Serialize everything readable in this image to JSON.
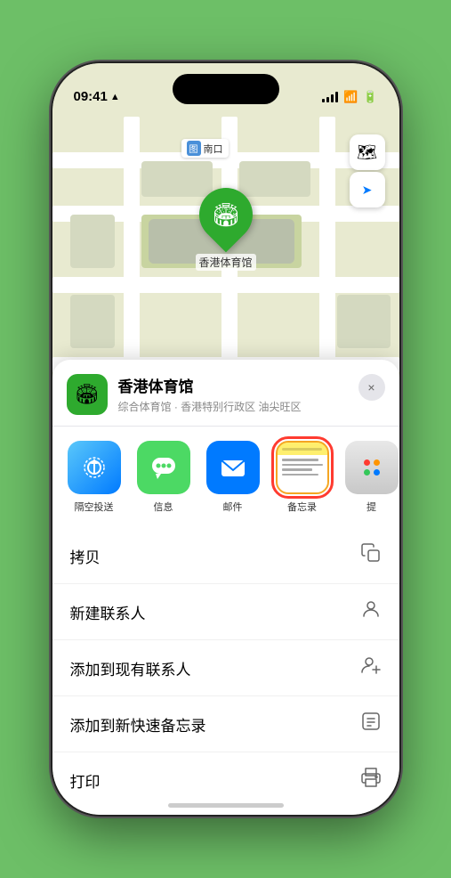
{
  "status_bar": {
    "time": "09:41",
    "location_icon": "▶"
  },
  "map": {
    "label_district": "南口",
    "marker_label": "香港体育馆",
    "marker_icon": "🏟"
  },
  "map_controls": {
    "layers_icon": "🗺",
    "location_icon": "➤"
  },
  "location_card": {
    "icon": "🏟",
    "name": "香港体育馆",
    "subtitle": "综合体育馆 · 香港特别行政区 油尖旺区",
    "close_label": "×"
  },
  "share_items": [
    {
      "id": "airdrop",
      "label": "隔空投送",
      "icon": "📡"
    },
    {
      "id": "messages",
      "label": "信息",
      "icon": "💬"
    },
    {
      "id": "mail",
      "label": "邮件",
      "icon": "✉"
    },
    {
      "id": "notes",
      "label": "备忘录",
      "icon": ""
    },
    {
      "id": "more",
      "label": "提",
      "icon": ""
    }
  ],
  "actions": [
    {
      "id": "copy",
      "label": "拷贝",
      "icon": "📋"
    },
    {
      "id": "new-contact",
      "label": "新建联系人",
      "icon": "👤"
    },
    {
      "id": "add-to-contact",
      "label": "添加到现有联系人",
      "icon": "👤➕"
    },
    {
      "id": "add-to-notes",
      "label": "添加到新快速备忘录",
      "icon": "📝"
    },
    {
      "id": "print",
      "label": "打印",
      "icon": "🖨"
    }
  ],
  "labels": {
    "copy": "拷贝",
    "new_contact": "新建联系人",
    "add_to_existing_contact": "添加到现有联系人",
    "add_to_notes": "添加到新快速备忘录",
    "print": "打印",
    "airdrop": "隔空投送",
    "messages": "信息",
    "mail": "邮件",
    "notes": "备忘录",
    "more": "提"
  }
}
